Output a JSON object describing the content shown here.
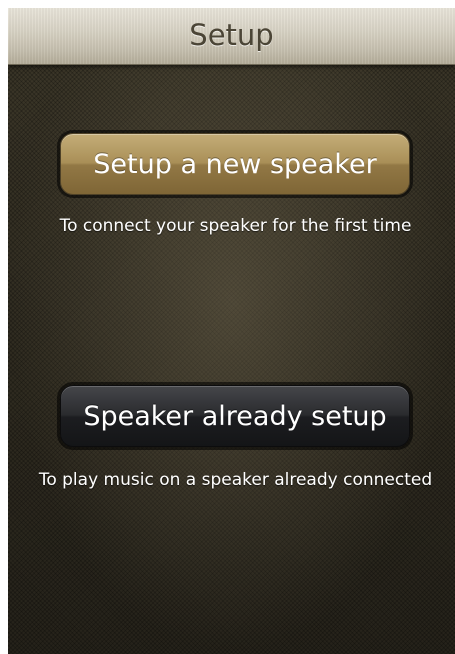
{
  "navbar": {
    "title": "Setup"
  },
  "options": [
    {
      "button_label": "Setup a new speaker",
      "description": "To connect your speaker for the first time"
    },
    {
      "button_label": "Speaker already setup",
      "description": "To play music on a speaker already connected"
    }
  ],
  "colors": {
    "navbar_background": "#d8d3c5",
    "title_text": "#4b4536",
    "primary_button": "#a98f57",
    "secondary_button": "#2a2b2e",
    "screen_background": "#3a3528",
    "text": "#ffffff"
  }
}
